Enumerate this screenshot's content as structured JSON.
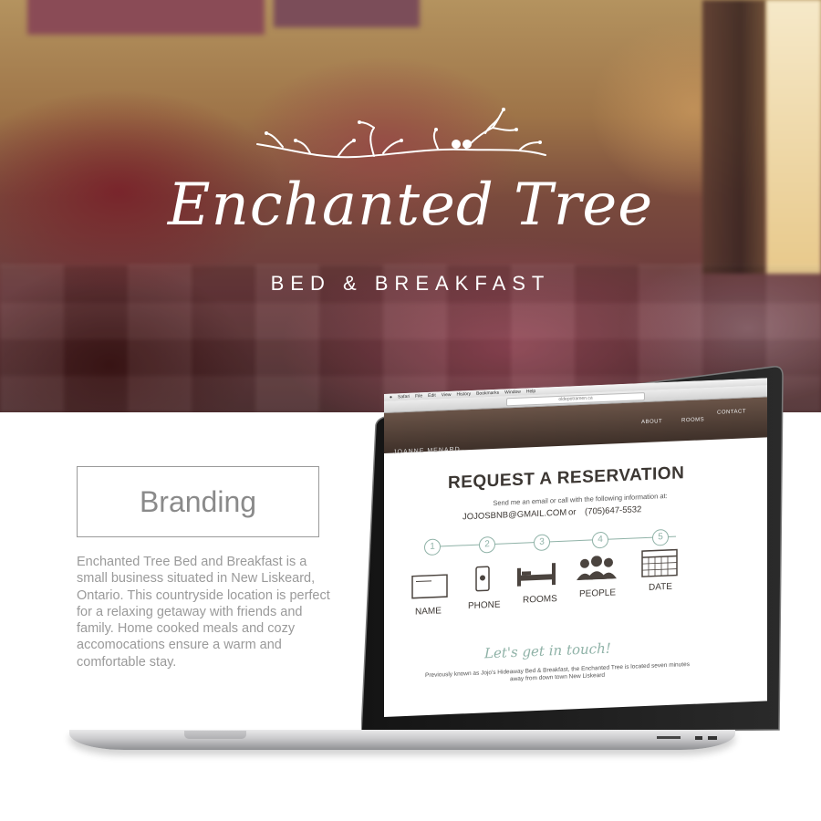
{
  "hero": {
    "logo_script": "Enchanted Tree",
    "logo_sub": "BED & BREAKFAST"
  },
  "branding": {
    "title": "Branding",
    "description": "Enchanted Tree Bed and Breakfast is a small business situated in New Liskeard, Ontario. This countryside location is perfect for a relaxing getaway with friends and family. Home cooked meals and cozy accomocations ensure a warm and comfortable stay."
  },
  "mac_menu": [
    "Safari",
    "File",
    "Edit",
    "View",
    "History",
    "Bookmarks",
    "Window",
    "Help"
  ],
  "browser": {
    "url": "oldepotramen.ca"
  },
  "site": {
    "nav": [
      "ABOUT",
      "ROOMS",
      "CONTACT"
    ],
    "brand": "JOANNE MENARD",
    "title": "REQUEST A RESERVATION",
    "info": "Send me an email or call with the following information at:",
    "email": "JOJOSBNB@GMAIL.COM",
    "or": "or",
    "phone": "(705)647-5532",
    "steps": [
      {
        "num": "1",
        "label": "NAME",
        "icon": "id-card-icon"
      },
      {
        "num": "2",
        "label": "PHONE",
        "icon": "phone-icon"
      },
      {
        "num": "3",
        "label": "ROOMS",
        "icon": "bed-icon"
      },
      {
        "num": "4",
        "label": "PEOPLE",
        "icon": "people-icon"
      },
      {
        "num": "5",
        "label": "DATE",
        "icon": "calendar-icon"
      }
    ],
    "touch": "Let's get in touch!",
    "previously": "Previously known as Jojo's Hideaway Bed & Breakfast, the Enchanted Tree is located seven minutes away from down town New Liskeard"
  }
}
